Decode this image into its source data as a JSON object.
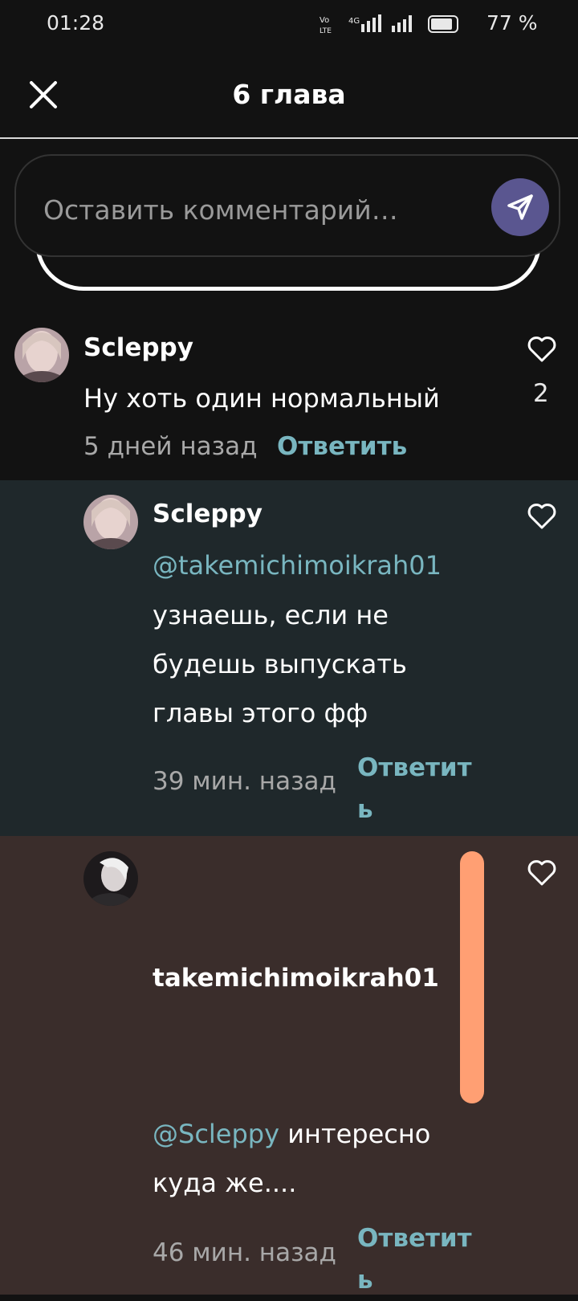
{
  "status": {
    "time": "01:28",
    "battery": "77 %"
  },
  "header": {
    "title": "6 глава"
  },
  "input": {
    "placeholder": "Оставить комментарий…"
  },
  "comments": [
    {
      "username": "Scleppy",
      "text": "Ну хоть один нормальный",
      "time": "5 дней назад",
      "reply": "Ответить",
      "likes": "2"
    },
    {
      "username": "Scleppy",
      "mention": "@takemichimoikrah01",
      "lines": [
        "узнаешь, если не",
        "будешь выпускать",
        "главы этого фф"
      ],
      "time": "39 мин. назад",
      "reply_line1": "Ответит",
      "reply_line2": "ь"
    },
    {
      "username": "takemichimoikrah01",
      "mention": "@Scleppy",
      "text_after_mention": " интересно",
      "line2": "куда же....",
      "time": "46 мин. назад",
      "reply_line1": "Ответит",
      "reply_line2": "ь"
    }
  ],
  "colors": {
    "accent": "#79b6c0",
    "send_button": "#5a5690",
    "scrollbar": "#ff9f73"
  },
  "icons": {
    "close": "close-icon",
    "send": "send-icon",
    "like": "heart-icon"
  }
}
